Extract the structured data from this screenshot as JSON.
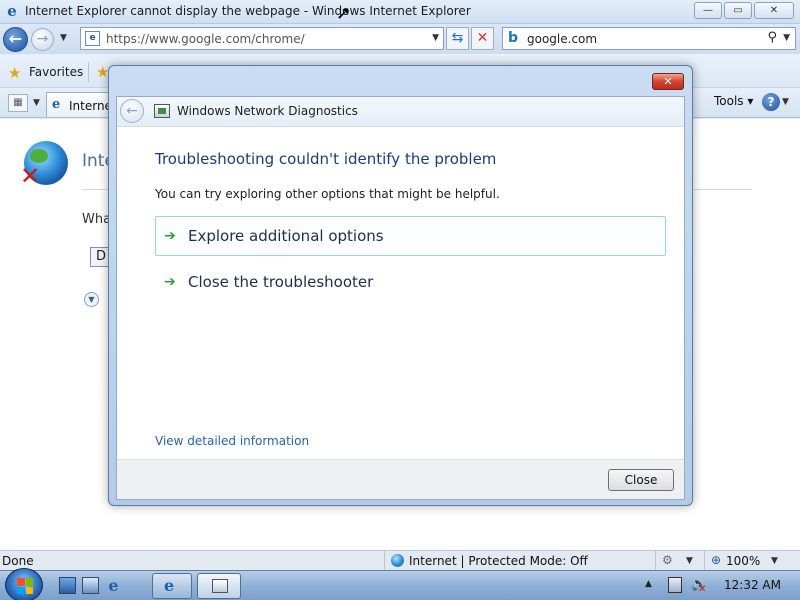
{
  "window": {
    "title": "Internet Explorer cannot display the webpage - Windows Internet Explorer",
    "minimize_glyph": "—",
    "maximize_glyph": "▭",
    "close_glyph": "✕"
  },
  "navbar": {
    "address": "https://www.google.com/chrome/",
    "search_query": "google.com",
    "search_provider_glyph": "b",
    "back_glyph": "←",
    "forward_glyph": "→",
    "refresh_glyph": "⇆",
    "stop_glyph": "✕",
    "search_glyph": "⚲"
  },
  "favorites_bar": {
    "favorites_label": "Favorites"
  },
  "tab_bar": {
    "tab_label": "Internet",
    "tools_label": "Tools",
    "help_glyph": "?"
  },
  "page": {
    "heading": "Inte",
    "prompt": "Wha",
    "diagnose_button": "D"
  },
  "status_bar": {
    "status": "Done",
    "zone": "Internet | Protected Mode: Off",
    "zoom": "100%"
  },
  "taskbar": {
    "clock": "12:32 AM"
  },
  "dialog": {
    "app_title": "Windows Network Diagnostics",
    "heading": "Troubleshooting couldn't identify the problem",
    "subtext": "You can try exploring other options that might be helpful.",
    "options": [
      {
        "label": "Explore additional options"
      },
      {
        "label": "Close the troubleshooter"
      }
    ],
    "detail_link": "View detailed information",
    "close_button": "Close",
    "title_close_glyph": "✕"
  },
  "icons": {
    "ie": "ie-logo-icon",
    "globe_error": "globe-error-icon",
    "option_arrow": "green-arrow-icon",
    "start": "windows-start-orb-icon"
  },
  "colors": {
    "heading_blue": "#1a3e78",
    "link_blue": "#2a63a6",
    "option_arrow_green": "#2f9a3a",
    "close_red": "#d5432f"
  }
}
